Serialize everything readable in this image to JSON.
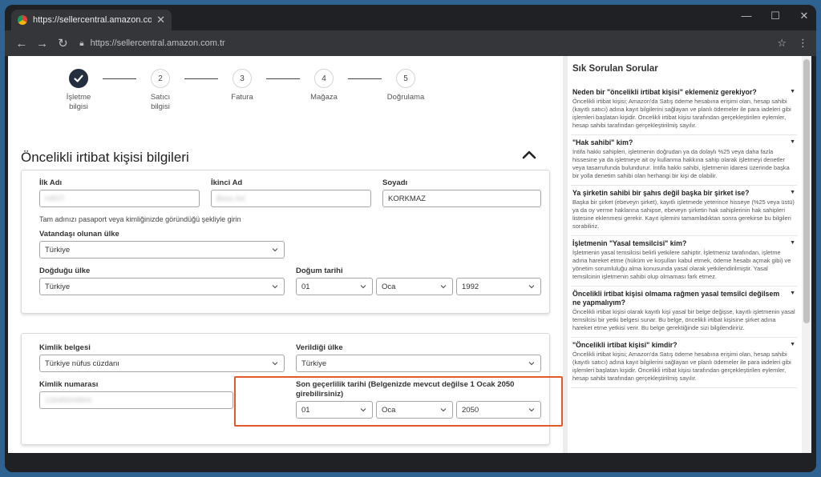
{
  "browser": {
    "tab_title": "https://sellercentral.amazon.com.tr",
    "url": "https://sellercentral.amazon.com.tr",
    "tab_close": "✕",
    "window_controls": {
      "minimize": "—",
      "maximize": "☐",
      "close": "✕"
    },
    "nav": {
      "back": "←",
      "forward": "→",
      "reload": "↻"
    },
    "star": "☆",
    "menu": "⋮"
  },
  "stepper": {
    "steps": [
      {
        "number": "",
        "label": "İşletme\nbilgisi",
        "state": "done"
      },
      {
        "number": "2",
        "label": "Satıcı\nbilgisi",
        "state": "pending"
      },
      {
        "number": "3",
        "label": "Fatura",
        "state": "pending"
      },
      {
        "number": "4",
        "label": "Mağaza",
        "state": "pending"
      },
      {
        "number": "5",
        "label": "Doğrulama",
        "state": "pending"
      }
    ]
  },
  "section": {
    "title": "Öncelikli irtibat kişisi bilgileri"
  },
  "personal": {
    "first_name_label": "İlk Adı",
    "first_name_value": "HIDIT",
    "middle_name_label": "İkinci Ad",
    "middle_name_value": "Bosu Ad",
    "last_name_label": "Soyadı",
    "last_name_value": "KORKMAZ",
    "name_hint": "Tam adınızı pasaport veya kimliğinizde göründüğü şekliyle girin",
    "citizenship_label": "Vatandaşı olunan ülke",
    "citizenship_value": "Türkiye",
    "birth_country_label": "Doğduğu ülke",
    "birth_country_value": "Türkiye",
    "birth_date_label": "Doğum tarihi",
    "birth_day": "01",
    "birth_month": "Oca",
    "birth_year": "1992"
  },
  "identity": {
    "id_type_label": "Kimlik belgesi",
    "id_type_value": "Türkiye nüfus cüzdanı",
    "issue_country_label": "Verildiği ülke",
    "issue_country_value": "Türkiye",
    "id_number_label": "Kimlik numarası",
    "id_number_value": "12645004804",
    "expiry_label": "Son geçerlilik tarihi (Belgenizde mevcut değilse 1 Ocak 2050 girebilirsiniz)",
    "expiry_day": "01",
    "expiry_month": "Oca",
    "expiry_year": "2050"
  },
  "faq": {
    "title": "Sık Sorulan Sorular",
    "items": [
      {
        "q": "Neden bir \"öncelikli irtibat kişisi\" eklemeniz gerekiyor?",
        "a": "Öncelikli irtibat kişisi; Amazon'da Satış ödeme hesabına erişimi olan, hesap sahibi (kayıtlı satıcı) adına kayıt bilgilerini sağlayan ve planlı ödemeler ile para iadeleri gibi işlemleri başlatan kişidir. Öncelikli irtibat kişisi tarafından gerçekleştirilen eylemler, hesap sahibi tarafından gerçekleştirilmiş sayılır."
      },
      {
        "q": "\"Hak sahibi\" kim?",
        "a": "İntifa hakkı sahipleri, işletmenin doğrudan ya da dolaylı %25 veya daha fazla hissesine ya da işletmeye ait oy kullanma hakkına sahip olarak işletmeyi denetler veya tasarrufunda bulundurur. İntifa hakkı sahibi, işletmenin idaresi üzerinde başka bir yolla denetim sahibi olan herhangi bir kişi de olabilir."
      },
      {
        "q": "Ya şirketin sahibi bir şahıs değil başka bir şirket ise?",
        "a": "Başka bir şirket (ebeveyn şirket), kayıtlı işletmede yeterince hisseye (%25 veya üstü) ya da oy verme haklarına sahipse, ebeveyn şirketin hak sahiplerinin hak sahipleri listesine eklenmesi gerekir. Kayıt işlemini tamamladıktan sonra gerekirse bu bilgileri sorabiliriz."
      },
      {
        "q": "İşletmenin \"Yasal temsilcisi\" kim?",
        "a": "İşletmenin yasal temsilcisi belirli yetkilere sahiptir. İşletmeniz tarafından, işletme adına hareket etme (hüküm ve koşulları kabul etmek, ödeme hesabı açmak gibi) ve yönetim sorumluluğu alma konusunda yasal olarak yetkilendirilmiştir. Yasal temsilcinin işletmenin sahibi olup olmaması fark etmez."
      },
      {
        "q": "Öncelikli irtibat kişisi olmama rağmen yasal temsilci değilsem ne yapmalıyım?",
        "a": "Öncelikli irtibat kişisi olarak kayıtlı kişi yasal bir belge değişse, kayıtlı işletmenin yasal temsilcisi bir yetki belgesi sunar. Bu belge, öncelikli irtibat kişisine şirket adına hareket etme yetkisi verir. Bu belge gerektiğinde sizi bilgilendiririz."
      },
      {
        "q": "\"Öncelikli irtibat kişisi\" kimdir?",
        "a": "Öncelikli irtibat kişisi; Amazon'da Satış ödeme hesabına erişimi olan, hesap sahibi (kayıtlı satıcı) adına kayıt bilgilerini sağlayan ve planlı ödemeler ile para iadeleri gibi işlemleri başlatan kişidir. Öncelikli irtibat kişisi tarafından gerçekleştirilen eylemler, hesap sahibi tarafından gerçekleştirilmiş sayılır."
      }
    ]
  },
  "colors": {
    "highlight": "#e05a2b",
    "step_done": "#232f3e"
  }
}
